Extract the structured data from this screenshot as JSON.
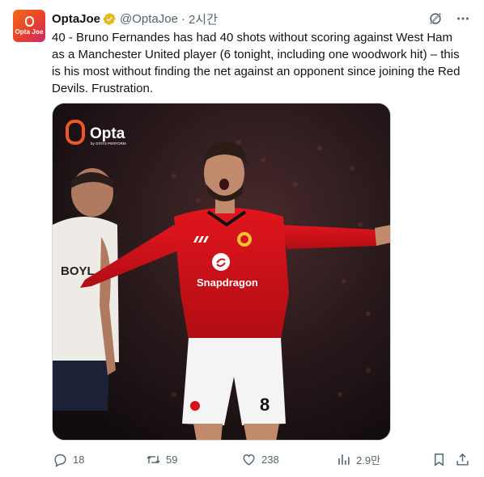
{
  "tweet": {
    "author_name": "OptaJoe",
    "handle": "@OptaJoe",
    "separator": "·",
    "time": "2시간",
    "avatar_text": "Opta Joe",
    "text": "40 - Bruno Fernandes has had 40 shots without scoring against West Ham as a Manchester United player (6 tonight, including one woodwork hit) – this is his most without finding the net against an opponent since joining the Red Devils. Frustration."
  },
  "media": {
    "logo_text": "Opta",
    "logo_subtext": "by STATS PERFORM",
    "sponsor_text": "Snapdragon",
    "shirt_number": "8",
    "opponent_shirt_text": "BOYL"
  },
  "actions": {
    "replies": "18",
    "retweets": "59",
    "likes": "238",
    "views": "2.9만"
  },
  "colors": {
    "verified_badge": "#e2b719",
    "secondary_text": "#536471",
    "primary_text": "#0f1419",
    "shirt_red": "#d3121a"
  }
}
